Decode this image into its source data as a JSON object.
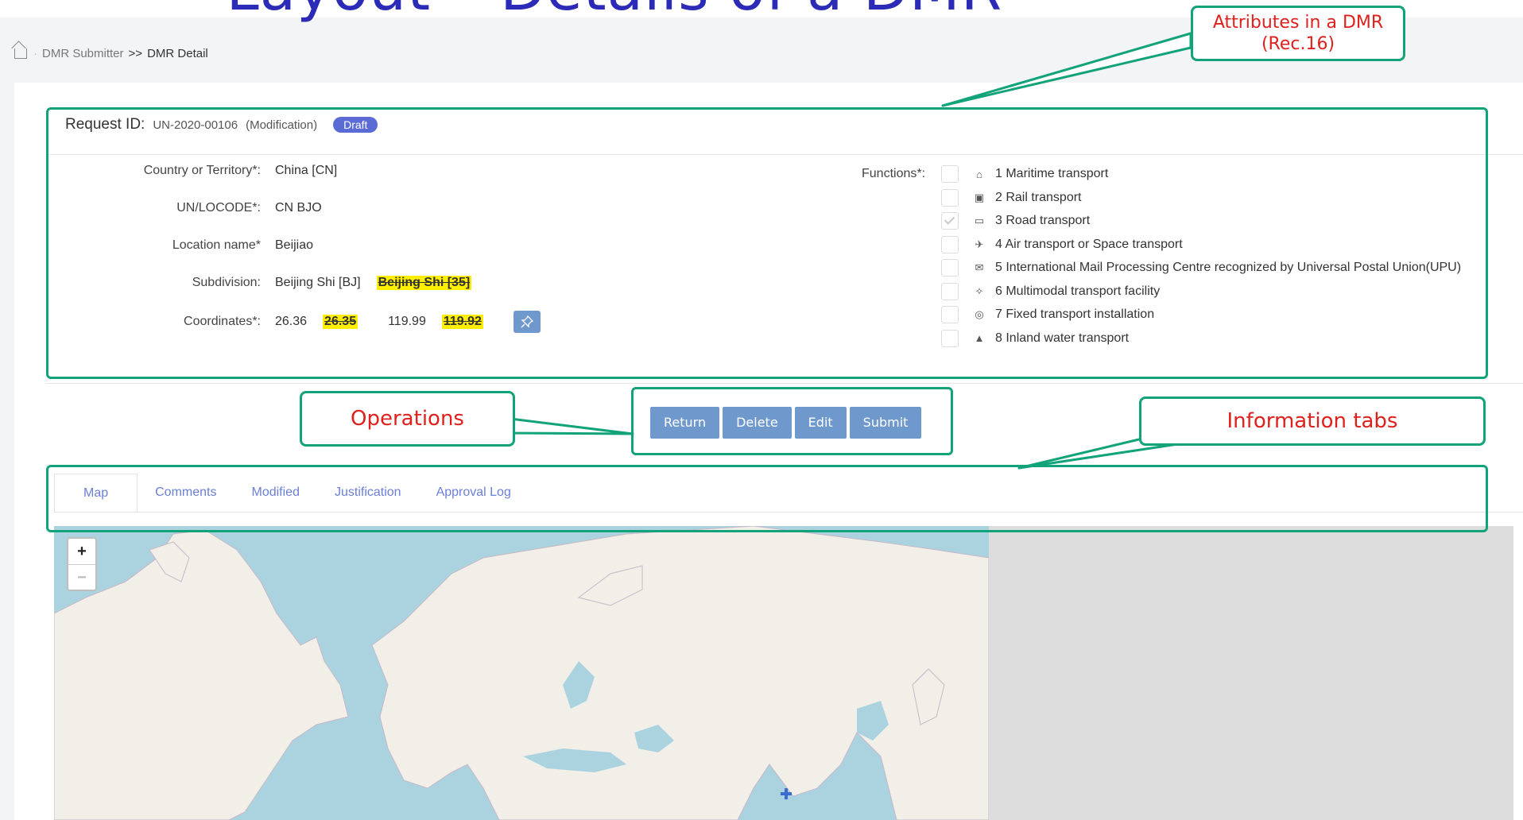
{
  "slide_title": "– Layout – Details of a DMR",
  "breadcrumb": {
    "parent": "DMR Submitter",
    "separator": ">>",
    "current": "DMR Detail"
  },
  "request": {
    "label": "Request ID:",
    "id": "UN-2020-00106",
    "type": "(Modification)",
    "status": "Draft"
  },
  "fields": {
    "country": {
      "label": "Country or Territory*:",
      "value": "China  [CN]"
    },
    "locode": {
      "label": "UN/LOCODE*:",
      "value": "CN BJO"
    },
    "location": {
      "label": "Location name*",
      "value": "Beijiao"
    },
    "subdivision": {
      "label": "Subdivision:",
      "value": "Beijing Shi  [BJ]",
      "old_value": "Beijing Shi [35]"
    },
    "coordinates": {
      "label": "Coordinates*:",
      "lat": "26.36",
      "old_lat": "26.35",
      "lon": "119.99",
      "old_lon": "119.92"
    }
  },
  "functions": {
    "label": "Functions*:",
    "items": [
      {
        "text": "1 Maritime transport",
        "icon": "ship-icon",
        "checked": false
      },
      {
        "text": "2 Rail transport",
        "icon": "train-icon",
        "checked": false
      },
      {
        "text": "3 Road transport",
        "icon": "truck-icon",
        "checked": true
      },
      {
        "text": "4 Air transport or Space transport",
        "icon": "plane-icon",
        "checked": false
      },
      {
        "text": "5 International Mail Processing Centre recognized by Universal Postal Union(UPU)",
        "icon": "mail-icon",
        "checked": false
      },
      {
        "text": "6 Multimodal transport facility",
        "icon": "multimodal-icon",
        "checked": false
      },
      {
        "text": "7 Fixed transport installation",
        "icon": "installation-icon",
        "checked": false
      },
      {
        "text": "8 Inland water transport",
        "icon": "boat-icon",
        "checked": false
      }
    ]
  },
  "buttons": {
    "return": "Return",
    "delete": "Delete",
    "edit": "Edit",
    "submit": "Submit"
  },
  "tabs": [
    "Map",
    "Comments",
    "Modified",
    "Justification",
    "Approval Log"
  ],
  "map": {
    "zoom_in": "+",
    "zoom_out": "−"
  },
  "callouts": {
    "attributes": "Attributes in a DMR (Rec.16)",
    "operations": "Operations",
    "tabs": "Information tabs"
  },
  "colors": {
    "accent": "#12a37a",
    "button": "#6f98cd",
    "callout_text": "#e0201c",
    "highlight": "#ffee00",
    "badge": "#5b6bd6",
    "title": "#2b2bb8"
  }
}
